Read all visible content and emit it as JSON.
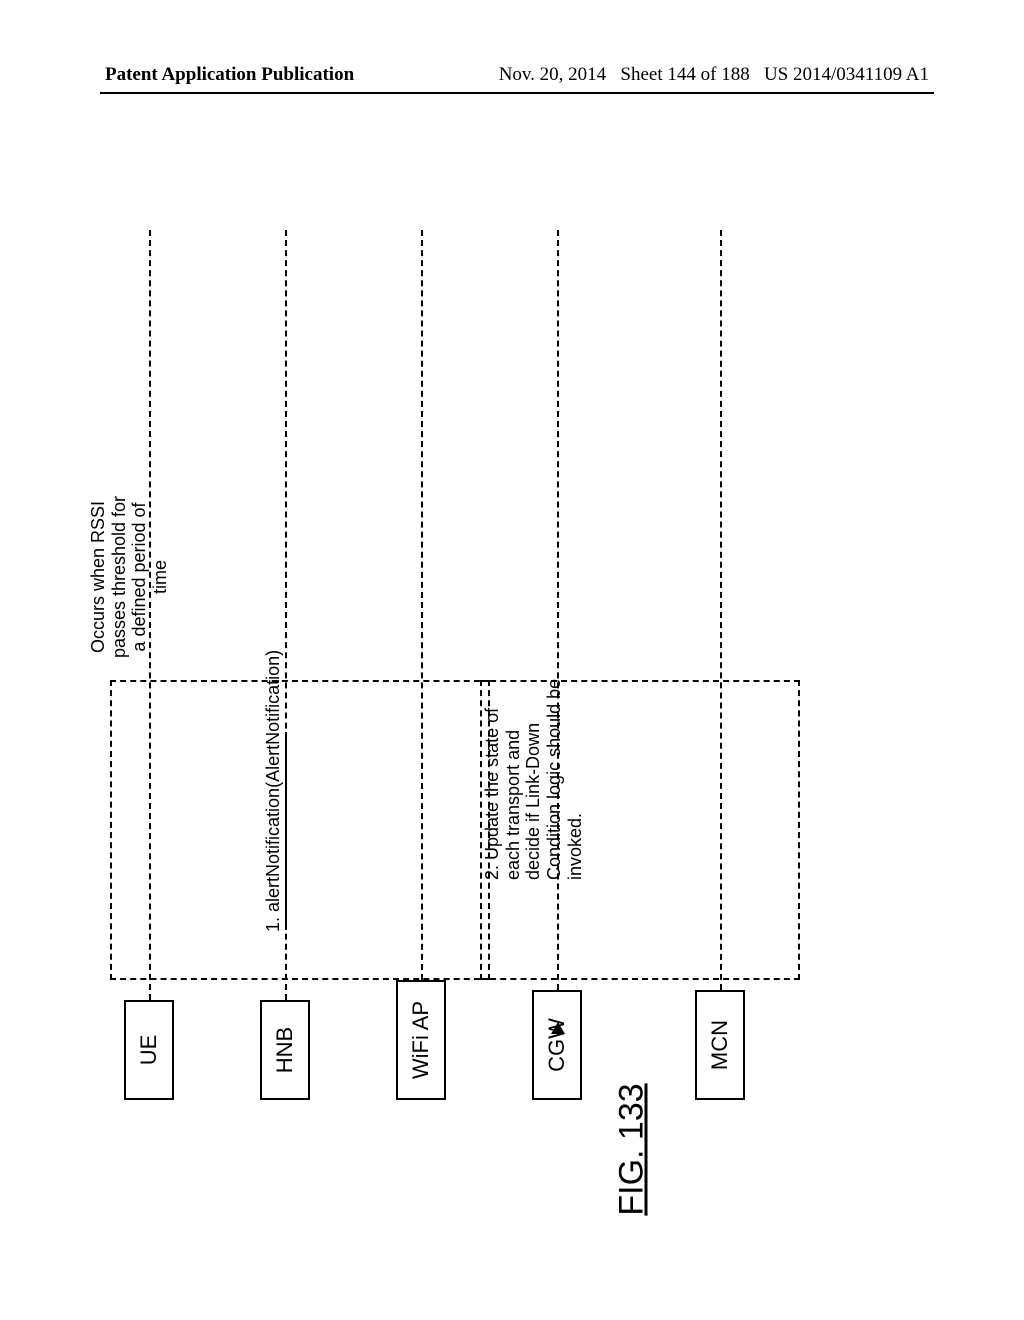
{
  "header": {
    "left": "Patent Application Publication",
    "right": "Nov. 20, 2014   Sheet 144 of 188   US 2014/0341109 A1"
  },
  "actors": {
    "ue": "UE",
    "hnb": "HNB",
    "wifi": "WiFi AP",
    "cgw": "CGW",
    "mcn": "MCN"
  },
  "messages": {
    "m1": "1. alertNotification(AlertNotification)"
  },
  "notes": {
    "n1": "Occurs when RSSI passes threshold for a defined period of time",
    "n2": "2. Update the state of each transport and decide if Link-Down Condition logic should be invoked."
  },
  "figure": {
    "label": "FIG. 133"
  }
}
